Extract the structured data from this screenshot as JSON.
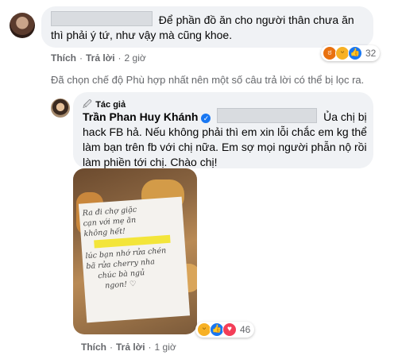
{
  "comment1": {
    "text": "Để phần đồ ăn cho người thân chưa ăn thì phải ý tứ, như vậy mà cũng khoe.",
    "actions": {
      "like": "Thích",
      "reply": "Trả lời",
      "time": "2 giờ"
    },
    "reactions": {
      "count": "32",
      "icons": [
        "angry-icon",
        "haha-icon",
        "like-icon"
      ]
    }
  },
  "filter_notice": "Đã chọn chế độ Phù hợp nhất nên một số câu trả lời có thể bị lọc ra.",
  "reply": {
    "badge": "Tác giả",
    "author": "Trần Phan Huy Khánh",
    "text": "Ủa chị bị hack FB hả. Nếu không phải thì em xin lỗi chắc em kg thể làm bạn trên fb với chị nữa. Em sợ mọi người phẫn nộ rồi làm phiền tới chị. Chào chị!",
    "photo_note_lines": [
      "Ra đi chợ giặc",
      "cạn với mẹ ăn",
      "không hết!",
      "",
      "lúc bạn nhớ rửa chén",
      "bã rửa cherry nha",
      "chúc bà ngủ",
      "ngon! ♡"
    ],
    "actions": {
      "like": "Thích",
      "reply": "Trả lời",
      "time": "1 giờ"
    },
    "reactions": {
      "count": "46",
      "icons": [
        "haha-icon",
        "like-icon",
        "love-icon"
      ]
    },
    "colors": {
      "like": "#1877f2",
      "love": "#f33e58",
      "haha": "#f7b125",
      "angry": "#e9710f"
    }
  }
}
